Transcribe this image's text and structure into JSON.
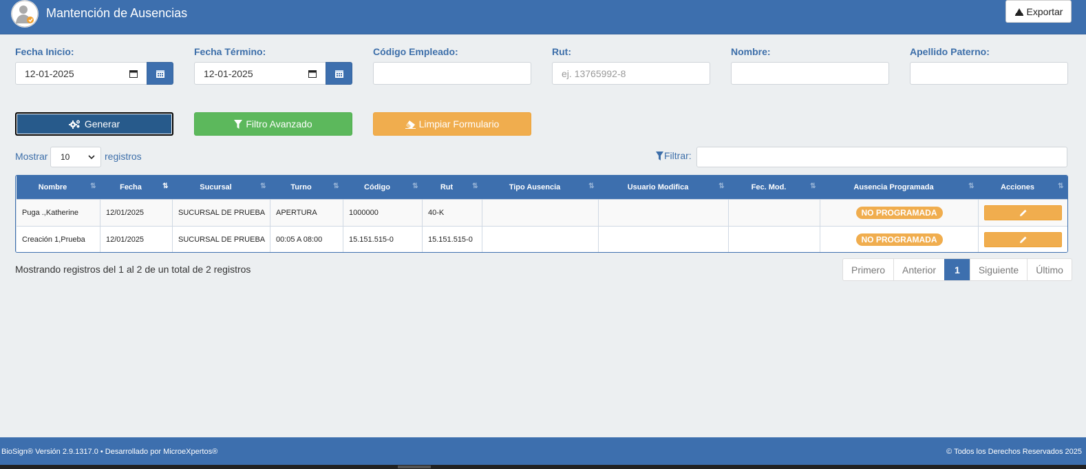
{
  "header": {
    "title": "Mantención de Ausencias",
    "export_label": "Exportar"
  },
  "filters": {
    "fecha_inicio": {
      "label": "Fecha Inicio:",
      "value": "12-01-2025"
    },
    "fecha_termino": {
      "label": "Fecha Término:",
      "value": "12-01-2025"
    },
    "codigo_empleado": {
      "label": "Código Empleado:",
      "value": ""
    },
    "rut": {
      "label": "Rut:",
      "placeholder": "ej. 13765992-8"
    },
    "nombre": {
      "label": "Nombre:",
      "value": ""
    },
    "apellido_paterno": {
      "label": "Apellido Paterno:",
      "value": ""
    }
  },
  "buttons": {
    "generar": "Generar",
    "filtro_avanzado": "Filtro Avanzado",
    "limpiar": "Limpiar Formulario"
  },
  "table_controls": {
    "show_label": "Mostrar",
    "page_length": "10",
    "records_label": "registros",
    "filter_label": "Filtrar:"
  },
  "table": {
    "columns": [
      "Nombre",
      "Fecha",
      "Sucursal",
      "Turno",
      "Código",
      "Rut",
      "Tipo Ausencia",
      "Usuario Modifica",
      "Fec. Mod.",
      "Ausencia Programada",
      "Acciones"
    ],
    "rows": [
      {
        "nombre": "Puga .,Katherine",
        "fecha": "12/01/2025",
        "sucursal": "SUCURSAL DE PRUEBA",
        "turno": "APERTURA",
        "codigo": "1000000",
        "rut": "40-K",
        "tipo": "",
        "usuario": "",
        "fec_mod": "",
        "programada": "NO PROGRAMADA"
      },
      {
        "nombre": "Creación 1,Prueba",
        "fecha": "12/01/2025",
        "sucursal": "SUCURSAL DE PRUEBA",
        "turno": "00:05 A 08:00",
        "codigo": "15.151.515-0",
        "rut": "15.151.515-0",
        "tipo": "",
        "usuario": "",
        "fec_mod": "",
        "programada": "NO PROGRAMADA"
      }
    ]
  },
  "info": "Mostrando registros del 1 al 2 de un total de 2 registros",
  "pagination": {
    "first": "Primero",
    "prev": "Anterior",
    "current": "1",
    "next": "Siguiente",
    "last": "Último"
  },
  "footer": {
    "left": "BioSign® Versión 2.9.1317.0 • Desarrollado por MicroeXpertos®",
    "right": "© Todos los Derechos Reservados 2025"
  },
  "colors": {
    "primary": "#3d6fae",
    "success": "#5cb85c",
    "warning": "#f0ad4e",
    "dark_button": "#275a8b"
  }
}
